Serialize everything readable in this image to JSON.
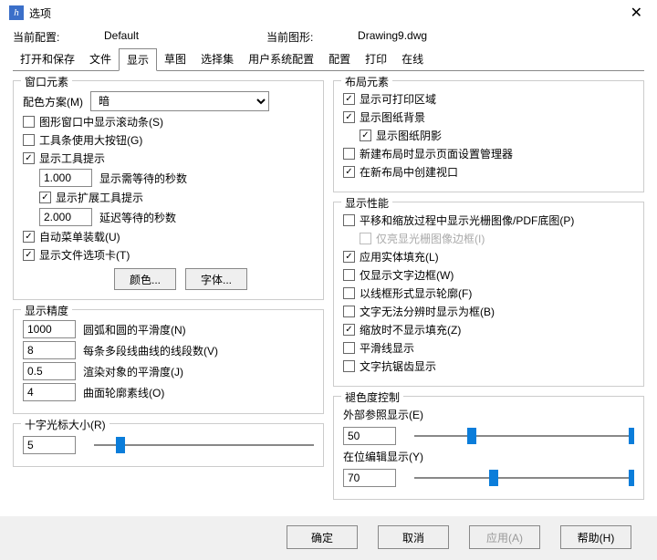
{
  "window": {
    "title": "选项"
  },
  "info": {
    "current_config_label": "当前配置:",
    "current_config_value": "Default",
    "current_drawing_label": "当前图形:",
    "current_drawing_value": "Drawing9.dwg"
  },
  "tabs": {
    "open_save": "打开和保存",
    "files": "文件",
    "display": "显示",
    "draft": "草图",
    "selection": "选择集",
    "user_sys": "用户系统配置",
    "config": "配置",
    "print": "打印",
    "online": "在线"
  },
  "window_elements": {
    "legend": "窗口元素",
    "color_scheme_label": "配色方案(M)",
    "color_scheme_value": "暗",
    "scrollbars": "图形窗口中显示滚动条(S)",
    "large_buttons": "工具条使用大按钮(G)",
    "tooltips": "显示工具提示",
    "tooltips_delay_value": "1.000",
    "tooltips_delay_label": "显示需等待的秒数",
    "ext_tooltips": "显示扩展工具提示",
    "ext_tooltips_delay_value": "2.000",
    "ext_tooltips_delay_label": "延迟等待的秒数",
    "auto_menu": "自动菜单装载(U)",
    "file_tabs": "显示文件选项卡(T)",
    "color_btn": "颜色...",
    "font_btn": "字体..."
  },
  "display_precision": {
    "legend": "显示精度",
    "arc_smooth_value": "1000",
    "arc_smooth_label": "圆弧和圆的平滑度(N)",
    "polyline_seg_value": "8",
    "polyline_seg_label": "每条多段线曲线的线段数(V)",
    "render_smooth_value": "0.5",
    "render_smooth_label": "渲染对象的平滑度(J)",
    "surf_contour_value": "4",
    "surf_contour_label": "曲面轮廓素线(O)"
  },
  "crosshair": {
    "legend": "十字光标大小(R)",
    "value": "5",
    "slider_pct": 10
  },
  "layout_elements": {
    "legend": "布局元素",
    "printable_area": "显示可打印区域",
    "paper_bg": "显示图纸背景",
    "paper_shadow": "显示图纸阴影",
    "page_setup_mgr": "新建布局时显示页面设置管理器",
    "create_viewport": "在新布局中创建视口"
  },
  "display_perf": {
    "legend": "显示性能",
    "pan_zoom_raster": "平移和缩放过程中显示光栅图像/PDF底图(P)",
    "highlight_frame": "仅亮显光栅图像边框(I)",
    "solid_fill": "应用实体填充(L)",
    "text_frame": "仅显示文字边框(W)",
    "lineframe_contour": "以线框形式显示轮廓(F)",
    "text_as_box": "文字无法分辨时显示为框(B)",
    "no_fill_on_zoom": "缩放时不显示填充(Z)",
    "smooth_line": "平滑线显示",
    "text_aa": "文字抗锯齿显示"
  },
  "fade": {
    "legend": "褪色度控制",
    "xref_label": "外部参照显示(E)",
    "xref_value": "50",
    "xref_slider_pct": 24,
    "inplace_label": "在位编辑显示(Y)",
    "inplace_value": "70",
    "inplace_slider_pct": 34
  },
  "buttons": {
    "ok": "确定",
    "cancel": "取消",
    "apply": "应用(A)",
    "help": "帮助(H)"
  }
}
